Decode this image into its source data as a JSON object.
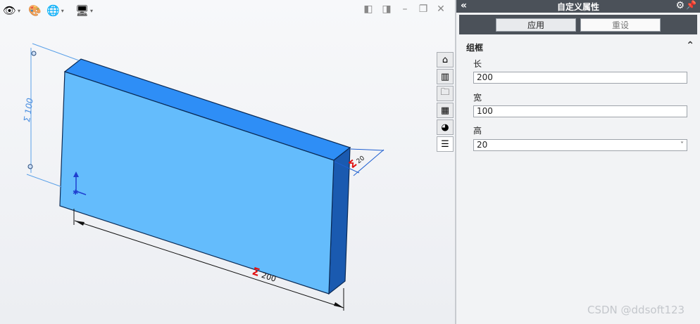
{
  "toolbar": {
    "items": [
      {
        "name": "view-display-icon",
        "glyph": "👁"
      },
      {
        "name": "appearance-icon",
        "glyph": "🎨"
      },
      {
        "name": "scene-icon",
        "glyph": "🌐"
      },
      {
        "name": "monitor-icon",
        "glyph": "🖥"
      }
    ],
    "dropdown_glyph": "▾",
    "window_controls": [
      "◧",
      "◨",
      "–",
      "❐",
      "✕"
    ]
  },
  "model": {
    "dim_height": "Σ 100",
    "dim_length": "Σ 200",
    "dim_thickness": "Σ 20",
    "face_color": "#64bcfc",
    "side_color": "#1a5ab0",
    "top_color": "#2e8ef6"
  },
  "task_tabs": [
    {
      "name": "home-icon",
      "glyph": "⌂"
    },
    {
      "name": "parts-library-icon",
      "glyph": "▥"
    },
    {
      "name": "folder-icon",
      "glyph": "🗀"
    },
    {
      "name": "view-palette-icon",
      "glyph": "▦"
    },
    {
      "name": "appearance-tab-icon",
      "glyph": "◕"
    },
    {
      "name": "custom-properties-icon",
      "glyph": "☰"
    }
  ],
  "panel": {
    "title": "自定义属性",
    "collapse_glyph": "«",
    "gear_glyph": "⚙",
    "pin_glyph": "📌",
    "apply_label": "应用",
    "reset_label": "重设",
    "group_label": "组框",
    "group_chevron": "⌃",
    "fields": {
      "length": {
        "label": "长",
        "value": "200"
      },
      "width": {
        "label": "宽",
        "value": "100"
      },
      "height": {
        "label": "高",
        "value": "20"
      }
    },
    "select_chevron": "˅"
  },
  "watermark": "CSDN @ddsoft123",
  "colors": {
    "header_bg": "#4b5159",
    "panel_bg": "#f2f3f5"
  }
}
